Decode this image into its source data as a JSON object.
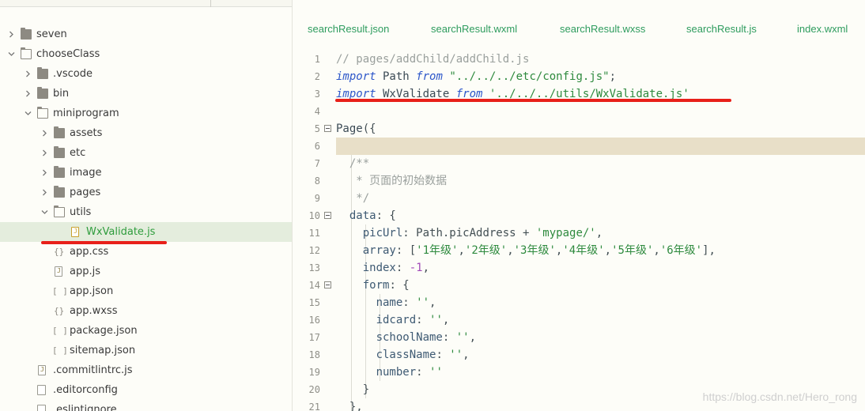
{
  "explorer": {
    "items": [
      {
        "label": "seven",
        "kind": "folder",
        "expanded": false,
        "depth": 0
      },
      {
        "label": "chooseClass",
        "kind": "folder",
        "expanded": true,
        "depth": 0
      },
      {
        "label": ".vscode",
        "kind": "folder",
        "expanded": false,
        "depth": 1
      },
      {
        "label": "bin",
        "kind": "folder",
        "expanded": false,
        "depth": 1
      },
      {
        "label": "miniprogram",
        "kind": "folder",
        "expanded": true,
        "depth": 1
      },
      {
        "label": "assets",
        "kind": "folder",
        "expanded": false,
        "depth": 2
      },
      {
        "label": "etc",
        "kind": "folder",
        "expanded": false,
        "depth": 2
      },
      {
        "label": "image",
        "kind": "folder",
        "expanded": false,
        "depth": 2
      },
      {
        "label": "pages",
        "kind": "folder",
        "expanded": false,
        "depth": 2
      },
      {
        "label": "utils",
        "kind": "folder",
        "expanded": true,
        "depth": 2
      },
      {
        "label": "WxValidate.js",
        "kind": "js",
        "selected": true,
        "depth": 3
      },
      {
        "label": "app.css",
        "kind": "css",
        "depth": 2
      },
      {
        "label": "app.js",
        "kind": "js",
        "depth": 2
      },
      {
        "label": "app.json",
        "kind": "json",
        "depth": 2
      },
      {
        "label": "app.wxss",
        "kind": "css",
        "depth": 2
      },
      {
        "label": "package.json",
        "kind": "json",
        "depth": 2
      },
      {
        "label": "sitemap.json",
        "kind": "json",
        "depth": 2
      },
      {
        "label": ".commitlintrc.js",
        "kind": "js",
        "depth": 1
      },
      {
        "label": ".editorconfig",
        "kind": "plain",
        "depth": 1
      },
      {
        "label": ".eslintignore",
        "kind": "plain",
        "depth": 1
      }
    ]
  },
  "tabs": [
    {
      "label": "searchResult.json"
    },
    {
      "label": "searchResult.wxml"
    },
    {
      "label": "searchResult.wxss"
    },
    {
      "label": "searchResult.js"
    },
    {
      "label": "index.wxml"
    }
  ],
  "code_lines": [
    {
      "n": "1",
      "fold": false,
      "tokens": [
        [
          "c-comment",
          "// pages/addChild/addChild.js"
        ]
      ]
    },
    {
      "n": "2",
      "fold": false,
      "tokens": [
        [
          "c-kw",
          "import"
        ],
        [
          "c-id",
          " Path "
        ],
        [
          "c-kw",
          "from"
        ],
        [
          "c-punc",
          " "
        ],
        [
          "c-str",
          "\"../../../etc/config.js\""
        ],
        [
          "c-punc",
          ";"
        ]
      ]
    },
    {
      "n": "3",
      "fold": false,
      "tokens": [
        [
          "c-kw",
          "import"
        ],
        [
          "c-id",
          " WxValidate "
        ],
        [
          "c-kw",
          "from"
        ],
        [
          "c-punc",
          " "
        ],
        [
          "c-str",
          "'../../../utils/WxValidate.js'"
        ]
      ]
    },
    {
      "n": "4",
      "fold": false,
      "tokens": []
    },
    {
      "n": "5",
      "fold": true,
      "tokens": [
        [
          "c-id",
          "Page"
        ],
        [
          "c-punc",
          "({"
        ]
      ]
    },
    {
      "n": "6",
      "fold": false,
      "highlight": true,
      "tokens": []
    },
    {
      "n": "7",
      "fold": false,
      "tokens": [
        [
          "c-comment",
          "  /**"
        ]
      ]
    },
    {
      "n": "8",
      "fold": false,
      "tokens": [
        [
          "c-comment",
          "   * 页面的初始数据"
        ]
      ]
    },
    {
      "n": "9",
      "fold": false,
      "tokens": [
        [
          "c-comment",
          "   */"
        ]
      ]
    },
    {
      "n": "10",
      "fold": true,
      "tokens": [
        [
          "c-prop",
          "  data"
        ],
        [
          "c-punc",
          ": {"
        ]
      ]
    },
    {
      "n": "11",
      "fold": false,
      "tokens": [
        [
          "c-prop",
          "    picUrl"
        ],
        [
          "c-punc",
          ": Path.picAddress + "
        ],
        [
          "c-str",
          "'mypage/'"
        ],
        [
          "c-punc",
          ","
        ]
      ]
    },
    {
      "n": "12",
      "fold": false,
      "tokens": [
        [
          "c-prop",
          "    array"
        ],
        [
          "c-punc",
          ": ["
        ],
        [
          "c-str",
          "'1年级'"
        ],
        [
          "c-punc",
          ","
        ],
        [
          "c-str",
          "'2年级'"
        ],
        [
          "c-punc",
          ","
        ],
        [
          "c-str",
          "'3年级'"
        ],
        [
          "c-punc",
          ","
        ],
        [
          "c-str",
          "'4年级'"
        ],
        [
          "c-punc",
          ","
        ],
        [
          "c-str",
          "'5年级'"
        ],
        [
          "c-punc",
          ","
        ],
        [
          "c-str",
          "'6年级'"
        ],
        [
          "c-punc",
          "],"
        ]
      ]
    },
    {
      "n": "13",
      "fold": false,
      "tokens": [
        [
          "c-prop",
          "    index"
        ],
        [
          "c-punc",
          ": "
        ],
        [
          "c-num",
          "-1"
        ],
        [
          "c-punc",
          ","
        ]
      ]
    },
    {
      "n": "14",
      "fold": true,
      "tokens": [
        [
          "c-prop",
          "    form"
        ],
        [
          "c-punc",
          ": {"
        ]
      ]
    },
    {
      "n": "15",
      "fold": false,
      "tokens": [
        [
          "c-prop",
          "      name"
        ],
        [
          "c-punc",
          ": "
        ],
        [
          "c-str",
          "''"
        ],
        [
          "c-punc",
          ","
        ]
      ]
    },
    {
      "n": "16",
      "fold": false,
      "tokens": [
        [
          "c-prop",
          "      idcard"
        ],
        [
          "c-punc",
          ": "
        ],
        [
          "c-str",
          "''"
        ],
        [
          "c-punc",
          ","
        ]
      ]
    },
    {
      "n": "17",
      "fold": false,
      "tokens": [
        [
          "c-prop",
          "      schoolName"
        ],
        [
          "c-punc",
          ": "
        ],
        [
          "c-str",
          "''"
        ],
        [
          "c-punc",
          ","
        ]
      ]
    },
    {
      "n": "18",
      "fold": false,
      "tokens": [
        [
          "c-prop",
          "      className"
        ],
        [
          "c-punc",
          ": "
        ],
        [
          "c-str",
          "''"
        ],
        [
          "c-punc",
          ","
        ]
      ]
    },
    {
      "n": "19",
      "fold": false,
      "tokens": [
        [
          "c-prop",
          "      number"
        ],
        [
          "c-punc",
          ": "
        ],
        [
          "c-str",
          "''"
        ]
      ]
    },
    {
      "n": "20",
      "fold": false,
      "tokens": [
        [
          "c-punc",
          "    }"
        ]
      ]
    },
    {
      "n": "21",
      "fold": false,
      "tokens": [
        [
          "c-punc",
          "  },"
        ]
      ]
    }
  ],
  "watermark": "https://blog.csdn.net/Hero_rong",
  "colors": {
    "tab_text": "#2e9c5e",
    "selected_row": "#e4eddd",
    "annotation_underline": "#e8201a",
    "current_line": "#e8dfc8"
  }
}
